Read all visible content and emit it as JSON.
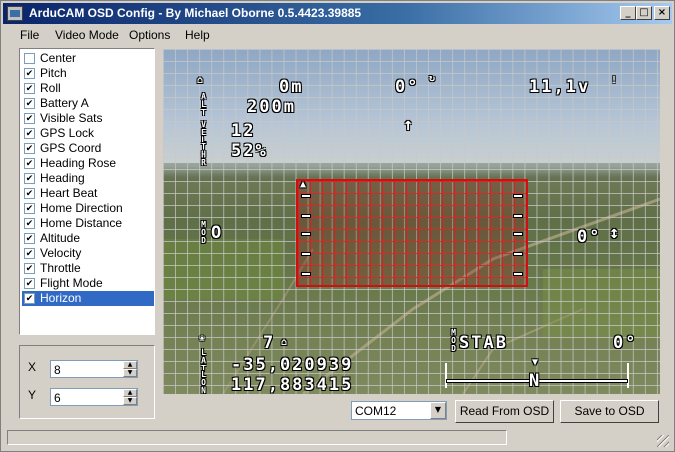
{
  "window": {
    "title": "ArduCAM OSD Config - By Michael Oborne 0.5.4423.39885"
  },
  "menu": [
    "File",
    "Video Mode",
    "Options",
    "Help"
  ],
  "panel_items": [
    {
      "label": "Center",
      "checked": false
    },
    {
      "label": "Pitch",
      "checked": true
    },
    {
      "label": "Roll",
      "checked": true
    },
    {
      "label": "Battery A",
      "checked": true
    },
    {
      "label": "Visible Sats",
      "checked": true
    },
    {
      "label": "GPS Lock",
      "checked": true
    },
    {
      "label": "GPS Coord",
      "checked": true
    },
    {
      "label": "Heading Rose",
      "checked": true
    },
    {
      "label": "Heading",
      "checked": true
    },
    {
      "label": "Heart Beat",
      "checked": true
    },
    {
      "label": "Home Direction",
      "checked": true
    },
    {
      "label": "Home Distance",
      "checked": true
    },
    {
      "label": "Altitude",
      "checked": true
    },
    {
      "label": "Velocity",
      "checked": true
    },
    {
      "label": "Throttle",
      "checked": true
    },
    {
      "label": "Flight Mode",
      "checked": true
    },
    {
      "label": "Horizon",
      "checked": true,
      "selected": true
    }
  ],
  "position": {
    "x_label": "X",
    "x_value": "8",
    "y_label": "Y",
    "y_value": "6"
  },
  "osd": {
    "home_distance": "0m",
    "altitude": "200m",
    "velocity": "12",
    "throttle": "52%",
    "heading_top": "0°",
    "battery": "11,1v",
    "pitch": "0°",
    "sats": "7",
    "mode": "STAB",
    "heading_right": "0°",
    "lat": "-35,020939",
    "lon": "117,883415",
    "compass_letter": "N"
  },
  "controls": {
    "port": "COM12",
    "read_button": "Read From OSD",
    "save_button": "Save to OSD"
  },
  "colors": {
    "title_start": "#0a246a",
    "selection": "#316ac5",
    "horizon": "#d01010"
  }
}
